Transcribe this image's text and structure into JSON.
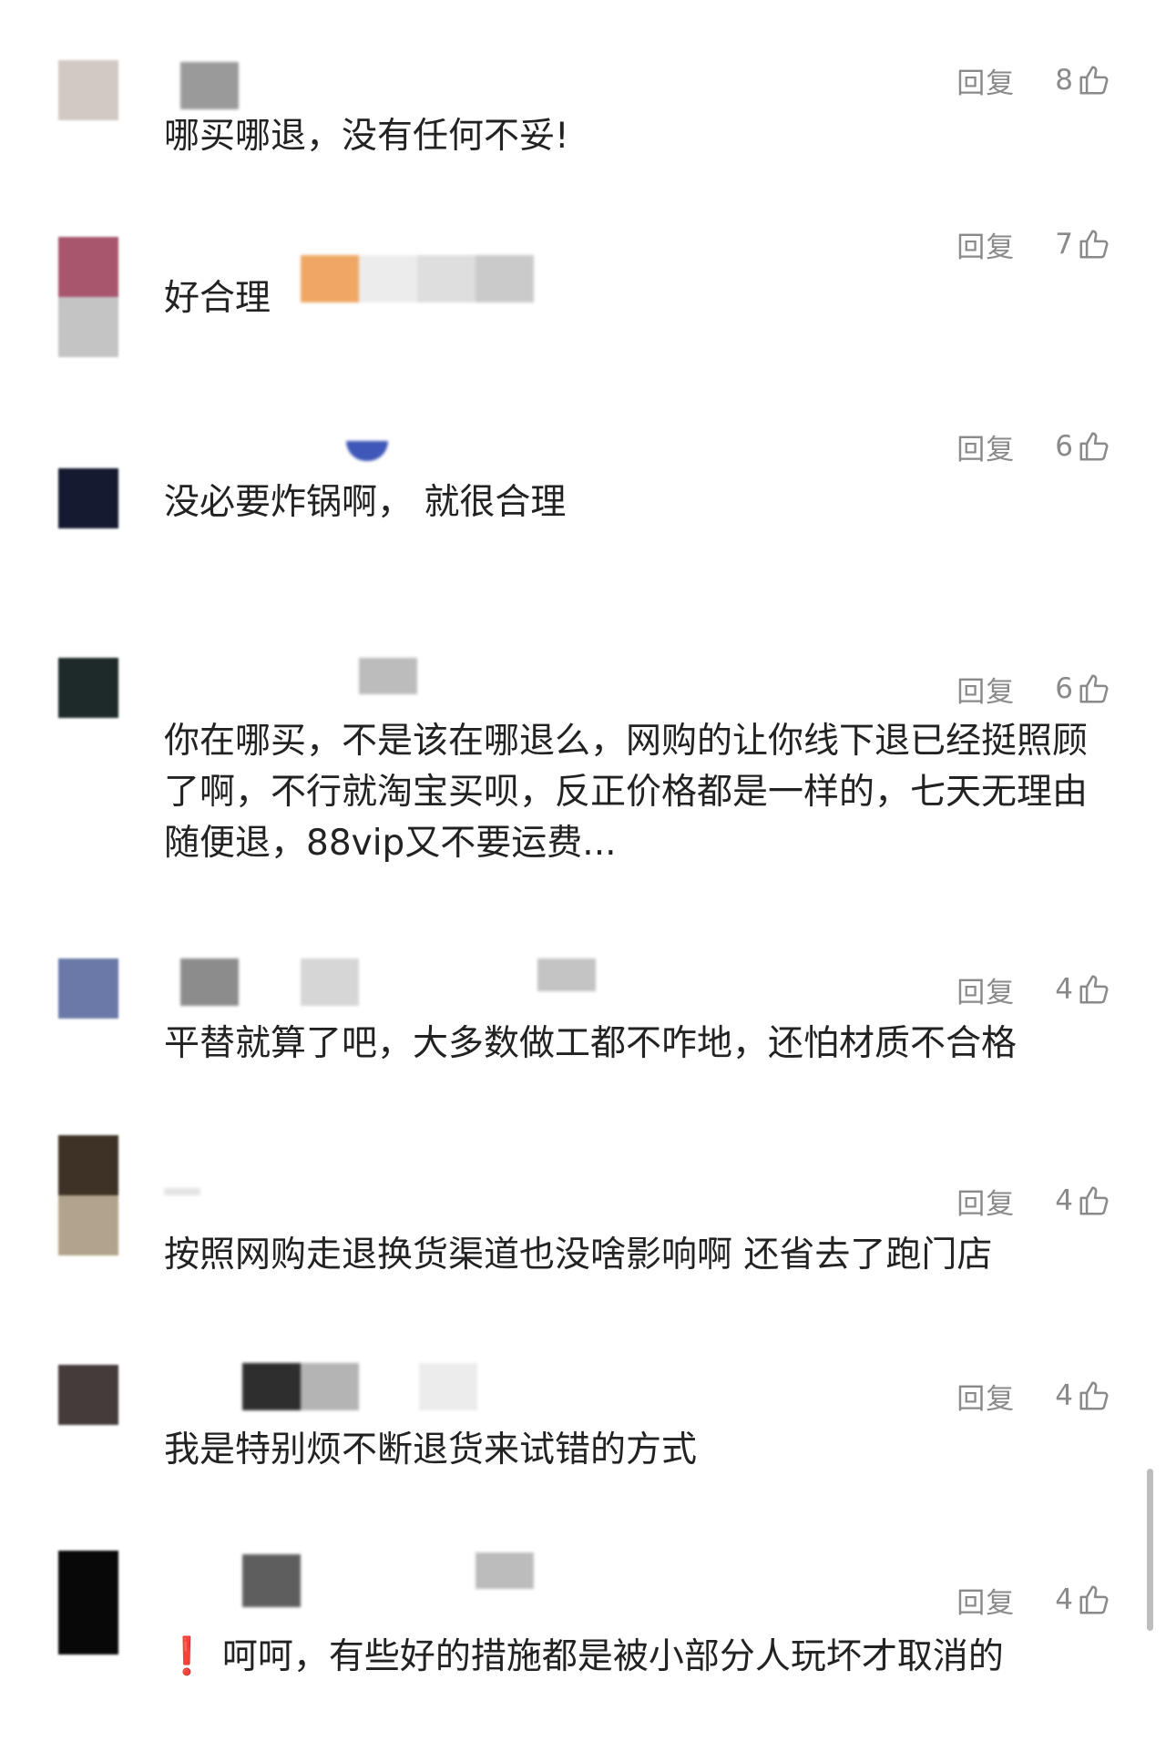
{
  "reply_label": "回复",
  "icons": {
    "like": "thumbs-up-icon",
    "warning": "exclamation-icon"
  },
  "colors": {
    "text": "#222222",
    "meta": "#8a8a8a",
    "warning": "#e03131"
  },
  "comments": [
    {
      "text": "哪买哪退，没有任何不妥!",
      "likes": "8"
    },
    {
      "text": "好合理",
      "likes": "7"
    },
    {
      "text": "没必要炸锅啊， 就很合理",
      "likes": "6"
    },
    {
      "text": "你在哪买，不是该在哪退么，网购的让你线下退已经挺照顾了啊，不行就淘宝买呗，反正价格都是一样的，七天无理由随便退，88vip又不要运费...",
      "likes": "6"
    },
    {
      "text": "平替就算了吧，大多数做工都不咋地，还怕材质不合格",
      "likes": "4"
    },
    {
      "text": "按照网购走退换货渠道也没啥影响啊 还省去了跑门店",
      "likes": "4"
    },
    {
      "text": "我是特别烦不断退货来试错的方式",
      "likes": "4"
    },
    {
      "text": "呵呵，有些好的措施都是被小部分人玩坏才取消的",
      "likes": "4"
    }
  ]
}
